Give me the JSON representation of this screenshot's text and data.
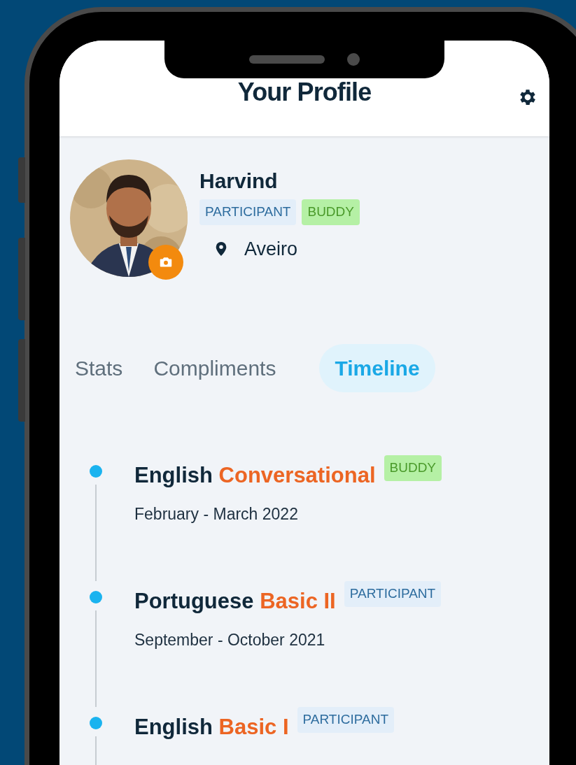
{
  "header": {
    "title": "Your Profile"
  },
  "profile": {
    "name": "Harvind",
    "badges": [
      {
        "label": "PARTICIPANT",
        "kind": "participant"
      },
      {
        "label": "BUDDY",
        "kind": "buddy"
      }
    ],
    "location": "Aveiro"
  },
  "tabs": [
    {
      "label": "Stats",
      "selected": false
    },
    {
      "label": "Compliments",
      "selected": false
    },
    {
      "label": "Timeline",
      "selected": true
    }
  ],
  "timeline": [
    {
      "language": "English",
      "level": "Conversational",
      "badge": {
        "label": "BUDDY",
        "kind": "buddy"
      },
      "dates": "February - March 2022"
    },
    {
      "language": "Portuguese",
      "level": "Basic II",
      "badge": {
        "label": "PARTICIPANT",
        "kind": "participant"
      },
      "dates": "September - October 2021"
    },
    {
      "language": "English",
      "level": "Basic I",
      "badge": {
        "label": "PARTICIPANT",
        "kind": "participant"
      }
    }
  ]
}
